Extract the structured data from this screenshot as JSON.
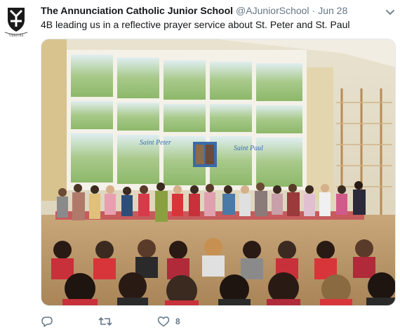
{
  "tweet": {
    "author_name": "The Annunciation Catholic Junior School",
    "handle": "@AJuniorSchool",
    "separator": "·",
    "date": "Jun 28",
    "text": "4B leading us in a reflective prayer service about St. Peter and St. Paul",
    "avatar_icon": "school-crest-icon",
    "avatar_motto": "VERITAS"
  },
  "photo": {
    "window_label_left": "Saint Peter",
    "window_label_right": "Saint Paul"
  },
  "actions": {
    "reply_icon": "reply-icon",
    "retweet_icon": "retweet-icon",
    "like_icon": "heart-icon",
    "like_count": "8"
  },
  "colors": {
    "text": "#14171a",
    "muted": "#657786",
    "border": "#e1e8ed"
  }
}
